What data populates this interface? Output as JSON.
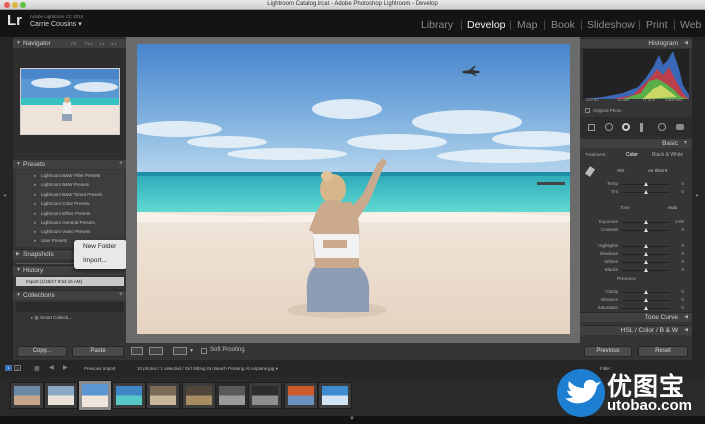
{
  "window": {
    "title": "Lightroom Catalog.lrcat - Adobe Photoshop Lightroom - Develop"
  },
  "identity": {
    "logo": "Lr",
    "app_version": "Adobe Lightroom CC 2015",
    "user": "Carrie Cousins"
  },
  "modules": [
    "Library",
    "Develop",
    "Map",
    "Book",
    "Slideshow",
    "Print",
    "Web"
  ],
  "active_module": "Develop",
  "left_panel": {
    "navigator": {
      "title": "Navigator",
      "zoom_options": [
        "FIT",
        "FILL",
        "1:1",
        "3:1"
      ]
    },
    "presets": {
      "title": "Presets",
      "items": [
        "Lightroom B&W Filter Presets",
        "Lightroom B&W Presets",
        "Lightroom B&W Toned Presets",
        "Lightroom Color Presets",
        "Lightroom Effect Presets",
        "Lightroom General Presets",
        "Lightroom Video Presets",
        "User Presets"
      ]
    },
    "snapshots": {
      "title": "Snapshots"
    },
    "history": {
      "title": "History",
      "entry": "Import (1/28/17 9:54:16 AM)"
    },
    "collections": {
      "title": "Collections",
      "item": "Smart Collecti..."
    },
    "copy_label": "Copy...",
    "paste_label": "Paste"
  },
  "context_menu": {
    "items": [
      "New Folder",
      "Import..."
    ]
  },
  "toolbar": {
    "soft_proofing": "Soft Proofing"
  },
  "right_panel": {
    "histogram": {
      "title": "Histogram",
      "readout": [
        "ISO 50",
        "15 mm",
        "f / 11.0",
        "1/500 sec"
      ],
      "original_photo": "Original Photo"
    },
    "basic": {
      "title": "Basic",
      "treatment_label": "Treatment :",
      "treatment_options": [
        "Color",
        "Black & White"
      ],
      "wb_label": "WB :",
      "wb_value": "As Shot",
      "tone_label": "Tone",
      "auto_label": "Auto",
      "presence_label": "Presence",
      "sliders": [
        {
          "label": "Temp",
          "value": "0",
          "pos": 0.5
        },
        {
          "label": "Tint",
          "value": "0",
          "pos": 0.5
        },
        {
          "label": "Exposure",
          "value": "0.00",
          "pos": 0.5
        },
        {
          "label": "Contrast",
          "value": "0",
          "pos": 0.5
        },
        {
          "label": "Highlights",
          "value": "0",
          "pos": 0.5
        },
        {
          "label": "Shadows",
          "value": "0",
          "pos": 0.5
        },
        {
          "label": "Whites",
          "value": "0",
          "pos": 0.5
        },
        {
          "label": "Blacks",
          "value": "0",
          "pos": 0.5
        },
        {
          "label": "Clarity",
          "value": "0",
          "pos": 0.5
        },
        {
          "label": "Vibrance",
          "value": "0",
          "pos": 0.5
        },
        {
          "label": "Saturation",
          "value": "0",
          "pos": 0.5
        }
      ]
    },
    "tone_curve": {
      "title": "Tone Curve"
    },
    "hsl": {
      "title": "HSL / Color / B & W"
    },
    "previous_label": "Previous",
    "reset_label": "Reset"
  },
  "filmstrip": {
    "nav_label": "Previous Import",
    "info": "10 photos / 1 selected / Girl Sitting On Beach Pointing At Airplane.jpg",
    "filter_label": "Filter :",
    "pages": [
      "1",
      "2"
    ]
  },
  "watermark": {
    "text": "优图宝",
    "url": "utobao.com"
  },
  "colors": {
    "panel": "#353535",
    "accent_blue": "#1c7fd1",
    "sky": "#4f8fd0",
    "sea": "#31c8c6",
    "sand": "#eee2d6"
  }
}
